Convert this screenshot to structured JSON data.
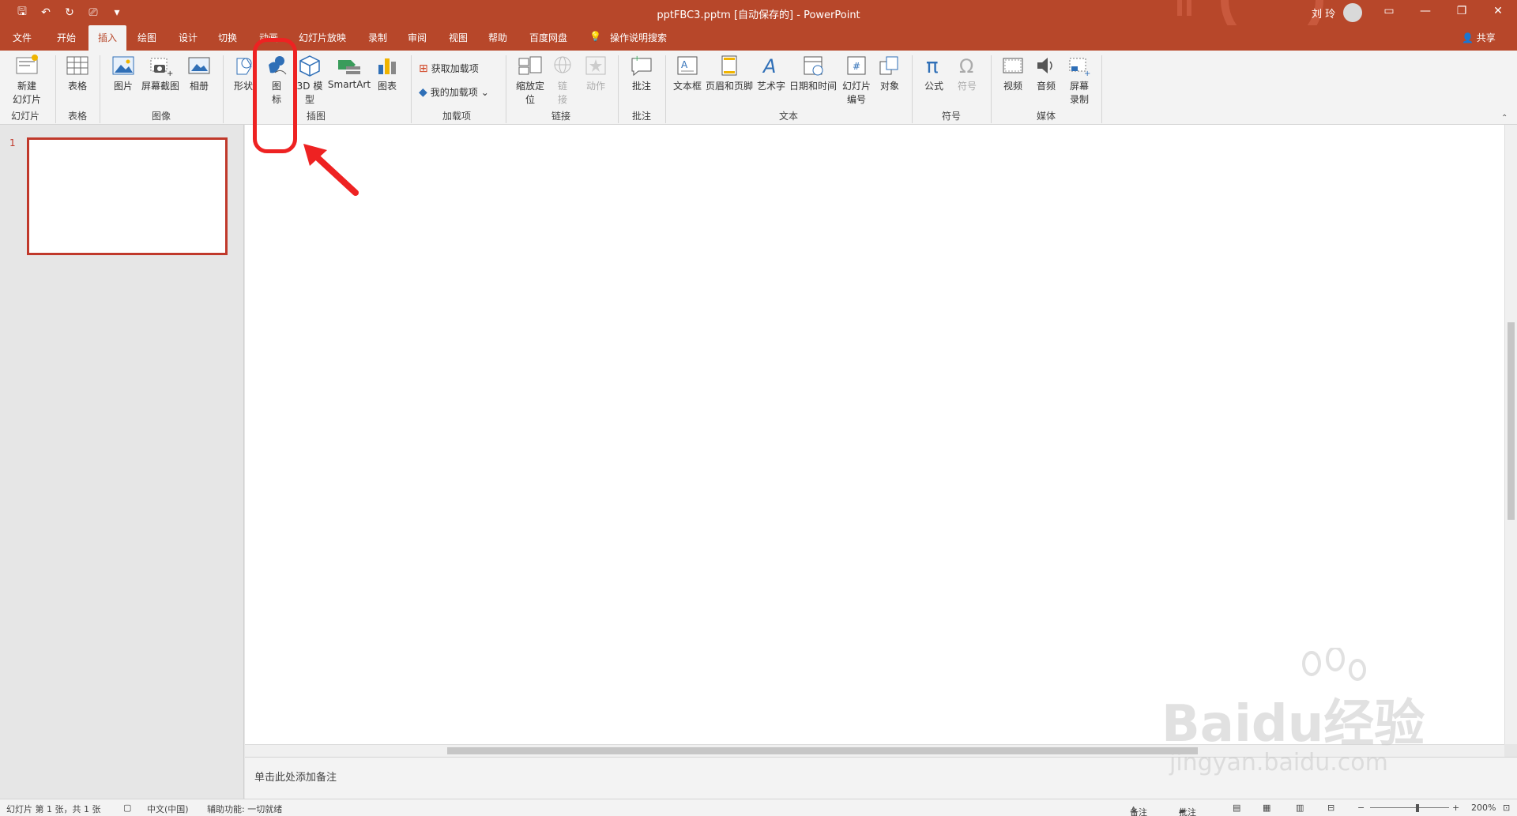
{
  "window": {
    "title": "pptFBC3.pptm [自动保存的]  -  PowerPoint",
    "user": "刘 玲"
  },
  "tabs": [
    {
      "label": "文件"
    },
    {
      "label": "开始"
    },
    {
      "label": "插入"
    },
    {
      "label": "绘图"
    },
    {
      "label": "设计"
    },
    {
      "label": "切换"
    },
    {
      "label": "动画"
    },
    {
      "label": "幻灯片放映"
    },
    {
      "label": "录制"
    },
    {
      "label": "审阅"
    },
    {
      "label": "视图"
    },
    {
      "label": "帮助"
    },
    {
      "label": "百度网盘"
    },
    {
      "label": "操作说明搜索"
    }
  ],
  "share_label": "共享",
  "ribbon": {
    "groups": {
      "slides": "幻灯片",
      "tables": "表格",
      "images": "图像",
      "illustrations": "插图",
      "addins": "加载项",
      "links": "链接",
      "comments": "批注",
      "text": "文本",
      "symbols": "符号",
      "media": "媒体"
    },
    "buttons": {
      "new_slide": "新建\n幻灯片",
      "table": "表格",
      "picture": "图片",
      "screenshot": "屏幕截图",
      "album": "相册",
      "shapes": "形状",
      "icons": "图\n标",
      "model3d": "3D 模\n型",
      "smartart": "SmartArt",
      "chart": "图表",
      "get_addins": "获取加载项",
      "my_addins": "我的加载项",
      "zoom": "缩放定\n位",
      "link": "链\n接",
      "action": "动作",
      "comment": "批注",
      "textbox": "文本框",
      "header_footer": "页眉和页脚",
      "wordart": "艺术字",
      "datetime": "日期和时间",
      "slide_number": "幻灯片\n编号",
      "object": "对象",
      "equation": "公式",
      "symbol": "符号",
      "video": "视频",
      "audio": "音频",
      "screen_record": "屏幕\n录制"
    }
  },
  "slides": [
    {
      "number": "1"
    }
  ],
  "notes_placeholder": "单击此处添加备注",
  "status": {
    "slide_info": "幻灯片 第 1 张，共 1 张",
    "language": "中文(中国)",
    "accessibility": "辅助功能: 一切就绪",
    "notes": "备注",
    "comments": "批注",
    "zoom": "200%"
  },
  "watermark": {
    "brand": "Baidu经验",
    "url": "jingyan.baidu.com"
  },
  "colors": {
    "accent": "#b7472a",
    "highlight": "#ee2222"
  }
}
